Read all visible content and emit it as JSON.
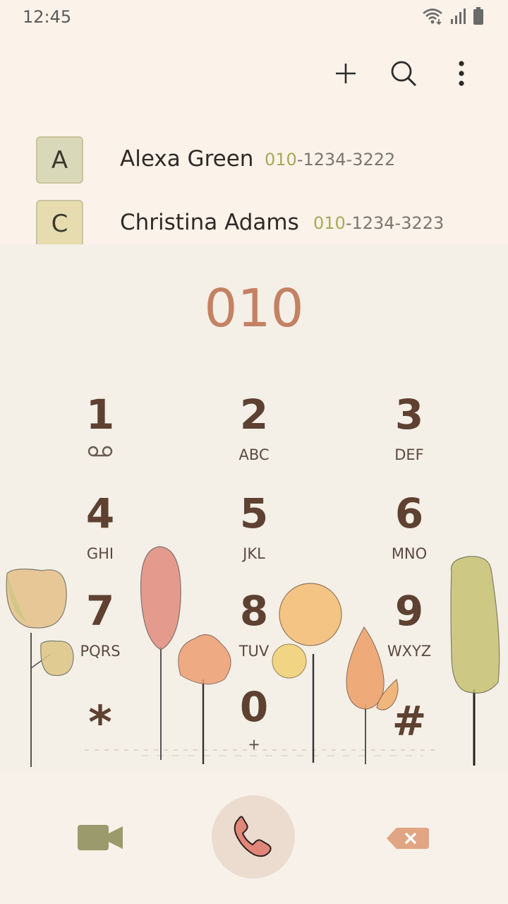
{
  "status": {
    "time": "12:45"
  },
  "actions": {
    "add_icon": "plus-icon",
    "search_icon": "search-icon",
    "more_icon": "more-vertical-icon"
  },
  "contacts": [
    {
      "initial": "A",
      "name": "Alexa Green",
      "number_highlight": "010",
      "number_rest": "-1234-3222"
    },
    {
      "initial": "C",
      "name": "Christina Adams",
      "number_highlight": "010",
      "number_rest": "-1234-3223"
    }
  ],
  "dialer": {
    "entered_number": "010",
    "keys": [
      {
        "digit": "1",
        "letters": ""
      },
      {
        "digit": "2",
        "letters": "ABC"
      },
      {
        "digit": "3",
        "letters": "DEF"
      },
      {
        "digit": "4",
        "letters": "GHI"
      },
      {
        "digit": "5",
        "letters": "JKL"
      },
      {
        "digit": "6",
        "letters": "MNO"
      },
      {
        "digit": "7",
        "letters": "PQRS"
      },
      {
        "digit": "8",
        "letters": "TUV"
      },
      {
        "digit": "9",
        "letters": "WXYZ"
      },
      {
        "digit": "*",
        "letters": ""
      },
      {
        "digit": "0",
        "letters": "+"
      },
      {
        "digit": "#",
        "letters": ""
      }
    ]
  },
  "bottom": {
    "video_icon": "video-call-icon",
    "call_icon": "phone-call-icon",
    "backspace_icon": "backspace-icon"
  },
  "colors": {
    "accent_number": "#c38263",
    "digit": "#5e4131",
    "highlight": "#a8a85a",
    "video": "#9a9a6c",
    "backspace": "#e0a583",
    "call": "#e0877a"
  }
}
